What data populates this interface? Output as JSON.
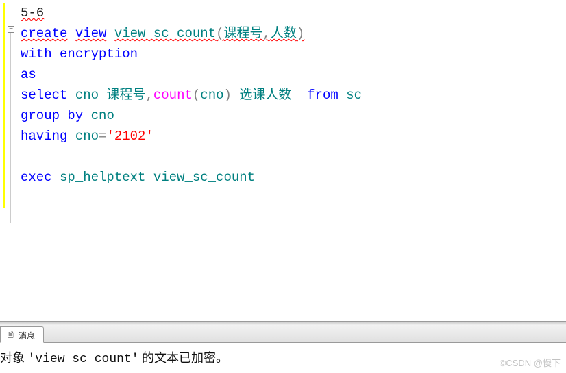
{
  "editor": {
    "line1_comment": "5-6",
    "create_view": {
      "kw_create": "create",
      "kw_view": "view",
      "view_name": "view_sc_count",
      "lp": "(",
      "col1": "课程号",
      "comma": ",",
      "col2": "人数",
      "rp": ")"
    },
    "with_enc": {
      "kw_with": "with",
      "kw_encryption": "encryption"
    },
    "kw_as": "as",
    "select_line": {
      "kw_select": "select",
      "col_cno": "cno",
      "alias1": "课程号",
      "comma": ",",
      "func_count": "count",
      "lp": "(",
      "arg": "cno",
      "rp": ")",
      "alias2": "选课人数",
      "kw_from": "from",
      "tbl": "sc"
    },
    "group_line": {
      "kw_group": "group",
      "kw_by": "by",
      "col": "cno"
    },
    "having_line": {
      "kw_having": "having",
      "col": "cno",
      "eq": "=",
      "lit": "'2102'"
    },
    "exec_line": {
      "kw_exec": "exec",
      "proc": "sp_helptext",
      "arg": "view_sc_count"
    }
  },
  "results": {
    "tab_label": "消息",
    "msg_prefix": "对象 ",
    "msg_obj": "'view_sc_count'",
    "msg_suffix": " 的文本已加密。"
  },
  "watermark": "©CSDN @慢下"
}
